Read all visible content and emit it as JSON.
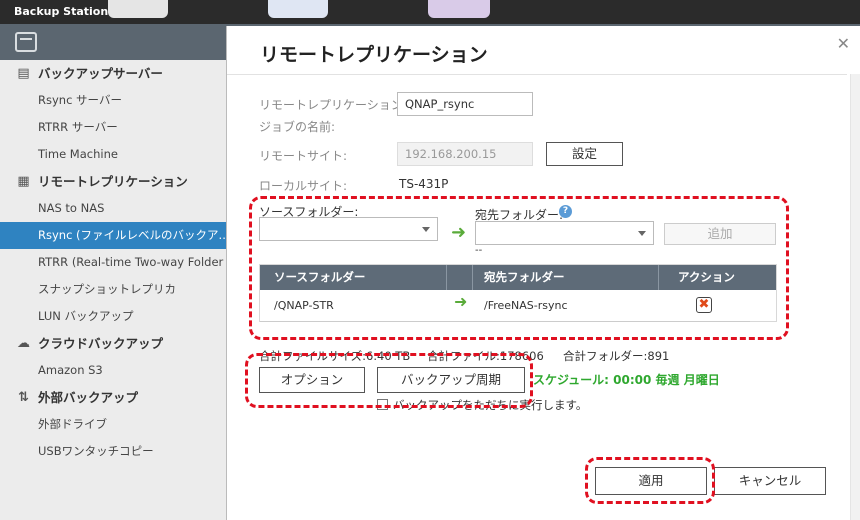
{
  "app": {
    "title": "Backup Station"
  },
  "sidebar": {
    "groups": [
      {
        "label": "バックアップサーバー",
        "icon": "server-icon",
        "items": [
          {
            "label": "Rsync サーバー"
          },
          {
            "label": "RTRR サーバー"
          },
          {
            "label": "Time Machine"
          }
        ]
      },
      {
        "label": "リモートレプリケーション",
        "icon": "replication-icon",
        "items": [
          {
            "label": "NAS to NAS"
          },
          {
            "label": "Rsync (ファイルレベルのバックア...",
            "active": true
          },
          {
            "label": "RTRR (Real-time Two-way Folder Sy..."
          },
          {
            "label": "スナップショットレプリカ"
          },
          {
            "label": "LUN バックアップ"
          }
        ]
      },
      {
        "label": "クラウドバックアップ",
        "icon": "cloud-icon",
        "items": [
          {
            "label": "Amazon S3"
          }
        ]
      },
      {
        "label": "外部バックアップ",
        "icon": "sync-icon",
        "items": [
          {
            "label": "外部ドライブ"
          },
          {
            "label": "USBワンタッチコピー"
          }
        ]
      }
    ]
  },
  "dialog": {
    "title": "リモートレプリケーション",
    "job_name_label_1": "リモートレプリケーション",
    "job_name_label_2": "ジョブの名前:",
    "job_name_value": "QNAP_rsync",
    "remote_site_label": "リモートサイト:",
    "remote_site_value": "192.168.200.15",
    "settings_button": "設定",
    "local_site_label": "ローカルサイト:",
    "local_site_value": "TS-431P",
    "source_folder_label": "ソースフォルダー:",
    "dest_folder_label": "宛先フォルダー:",
    "dest_hint": "--",
    "add_button": "追加",
    "table": {
      "columns": [
        "ソースフォルダー",
        "宛先フォルダー",
        "アクション"
      ],
      "rows": [
        {
          "source": "/QNAP-STR",
          "destination": "/FreeNAS-rsync"
        }
      ]
    },
    "total_size": "合計ファイルサイズ:6.40 TB",
    "total_files": "合計ファイル:178606",
    "total_folders": "合計フォルダー:891",
    "options_button": "オプション",
    "schedule_button": "バックアップ周期",
    "schedule_text": "スケジュール: 00:00 毎週 月曜日",
    "run_now_label": "バックアップをただちに実行します。",
    "apply_button": "適用",
    "cancel_button": "キャンセル"
  },
  "colors": {
    "accent": "#2f83c1",
    "highlight": "#e01020",
    "schedule_green": "#2fa82f",
    "table_header": "#5e6b78"
  }
}
